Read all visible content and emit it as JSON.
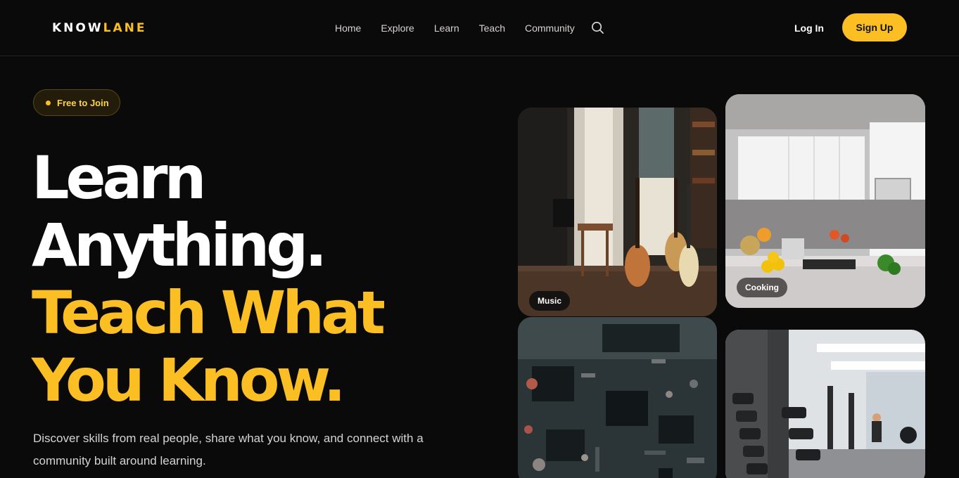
{
  "nav": {
    "logo_part1": "KNOW",
    "logo_part2": "LANE",
    "links": [
      "Home",
      "Explore",
      "Learn",
      "Teach",
      "Community"
    ],
    "search_icon": "search-icon",
    "login_label": "Log In",
    "signup_label": "Sign Up"
  },
  "hero": {
    "badge": "Free to Join",
    "headline_line1": "Learn",
    "headline_line2": "Anything.",
    "headline_line3": "Teach What",
    "headline_line4": "You Know.",
    "subtext": "Discover skills from real people, share what you know, and connect with a community built around learning."
  },
  "cards": {
    "music_label": "Music",
    "cooking_label": "Cooking"
  },
  "colors": {
    "accent": "#fbbf24",
    "background": "#0b0a0a"
  }
}
